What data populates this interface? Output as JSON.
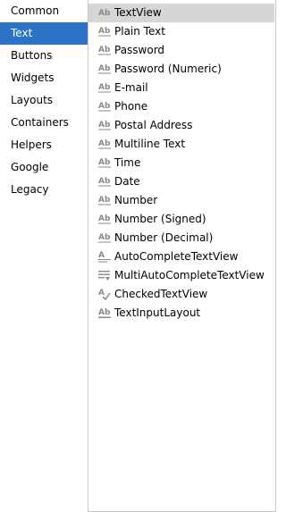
{
  "categories": [
    {
      "label": "Common"
    },
    {
      "label": "Text"
    },
    {
      "label": "Buttons"
    },
    {
      "label": "Widgets"
    },
    {
      "label": "Layouts"
    },
    {
      "label": "Containers"
    },
    {
      "label": "Helpers"
    },
    {
      "label": "Google"
    },
    {
      "label": "Legacy"
    }
  ],
  "active_category": "Text",
  "palette_items": [
    {
      "label": "TextView",
      "icon": "textview-icon"
    },
    {
      "label": "Plain Text",
      "icon": "edittext-icon"
    },
    {
      "label": "Password",
      "icon": "edittext-icon"
    },
    {
      "label": "Password (Numeric)",
      "icon": "edittext-icon"
    },
    {
      "label": "E-mail",
      "icon": "edittext-icon"
    },
    {
      "label": "Phone",
      "icon": "edittext-icon"
    },
    {
      "label": "Postal Address",
      "icon": "edittext-icon"
    },
    {
      "label": "Multiline Text",
      "icon": "edittext-icon"
    },
    {
      "label": "Time",
      "icon": "edittext-icon"
    },
    {
      "label": "Date",
      "icon": "edittext-icon"
    },
    {
      "label": "Number",
      "icon": "edittext-icon"
    },
    {
      "label": "Number (Signed)",
      "icon": "edittext-icon"
    },
    {
      "label": "Number (Decimal)",
      "icon": "edittext-icon"
    },
    {
      "label": "AutoCompleteTextView",
      "icon": "autocomplete-icon"
    },
    {
      "label": "MultiAutoCompleteTextView",
      "icon": "multi-autocomplete-icon"
    },
    {
      "label": "CheckedTextView",
      "icon": "checked-textview-icon"
    },
    {
      "label": "TextInputLayout",
      "icon": "textinputlayout-icon"
    }
  ],
  "selected_item": "TextView",
  "colors": {
    "active_category_bg": "#2a73c5",
    "selected_item_bg": "#d6d6d6",
    "icon_gray": "#8a8a8a"
  }
}
